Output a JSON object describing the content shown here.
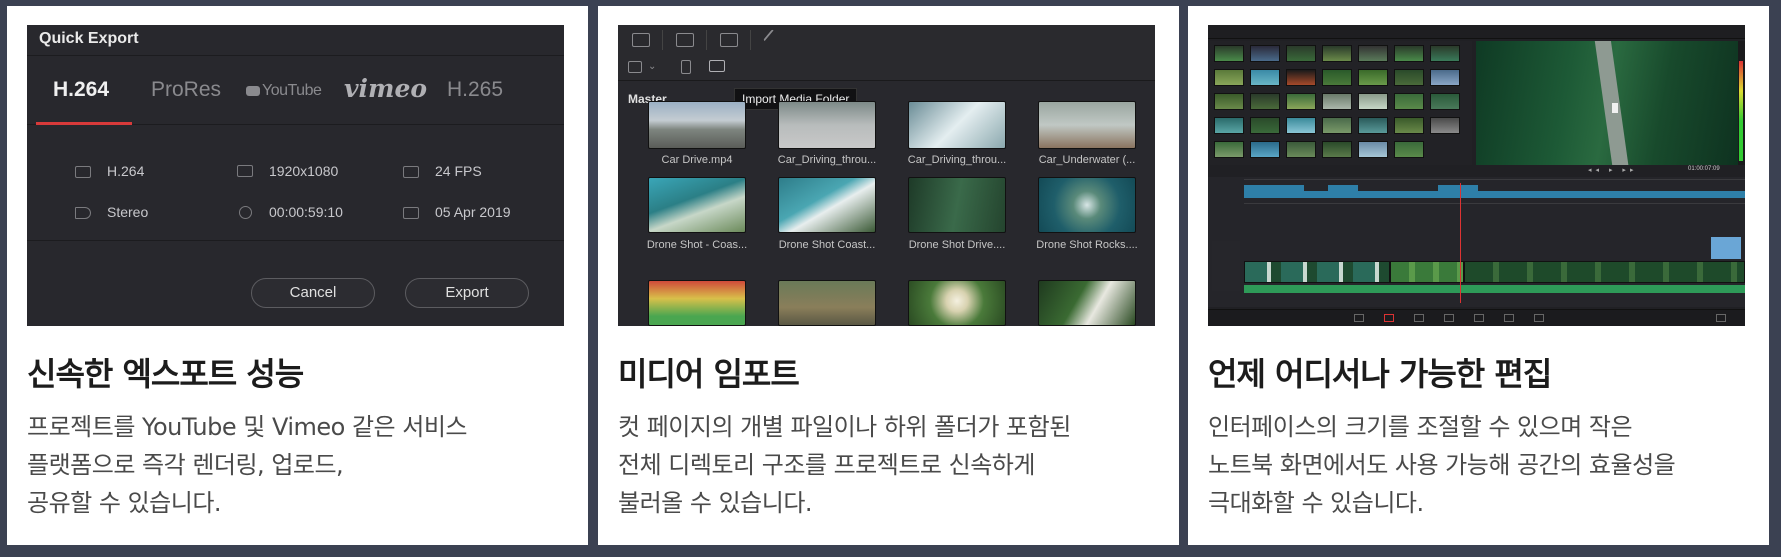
{
  "cards": [
    {
      "title": "신속한 엑스포트 성능",
      "desc_lines": [
        "프로젝트를 YouTube 및 Vimeo 같은 서비스",
        "플랫폼으로 즉각 렌더링, 업로드,",
        "공유할 수 있습니다."
      ],
      "screenshot": {
        "title": "Quick Export",
        "tabs": [
          "H.264",
          "ProRes",
          "YouTube",
          "vimeo",
          "H.265"
        ],
        "active_tab": "H.264",
        "info": {
          "codec": "H.264",
          "resolution": "1920x1080",
          "fps": "24 FPS",
          "audio": "Stereo",
          "duration": "00:00:59:10",
          "date": "05 Apr 2019"
        },
        "cancel_label": "Cancel",
        "export_label": "Export",
        "accent_color": "#d83a3a"
      }
    },
    {
      "title": "미디어 임포트",
      "desc_lines": [
        "컷 페이지의 개별 파일이나 하위 폴더가 포함된",
        "전체 디렉토리 구조를 프로젝트로 신속하게",
        "불러올 수 있습니다."
      ],
      "screenshot": {
        "master_label": "Master",
        "tooltip": "Import Media Folder",
        "captions": [
          "Car Drive.mp4",
          "Car_Driving_throu...",
          "Car_Driving_throu...",
          "Car_Underwater (...",
          "Drone Shot - Coas...",
          "Drone Shot Coast...",
          "Drone Shot Drive....",
          "Drone Shot Rocks...."
        ]
      }
    },
    {
      "title": "언제 어디서나 가능한 편집",
      "desc_lines": [
        "인터페이스의 크기를 조절할 수 있으며 작은",
        "노트북 화면에서도 사용 가능해 공간의 효율성을",
        "극대화할 수 있습니다."
      ],
      "screenshot": {
        "timecode": "01:00:07:09"
      }
    }
  ]
}
